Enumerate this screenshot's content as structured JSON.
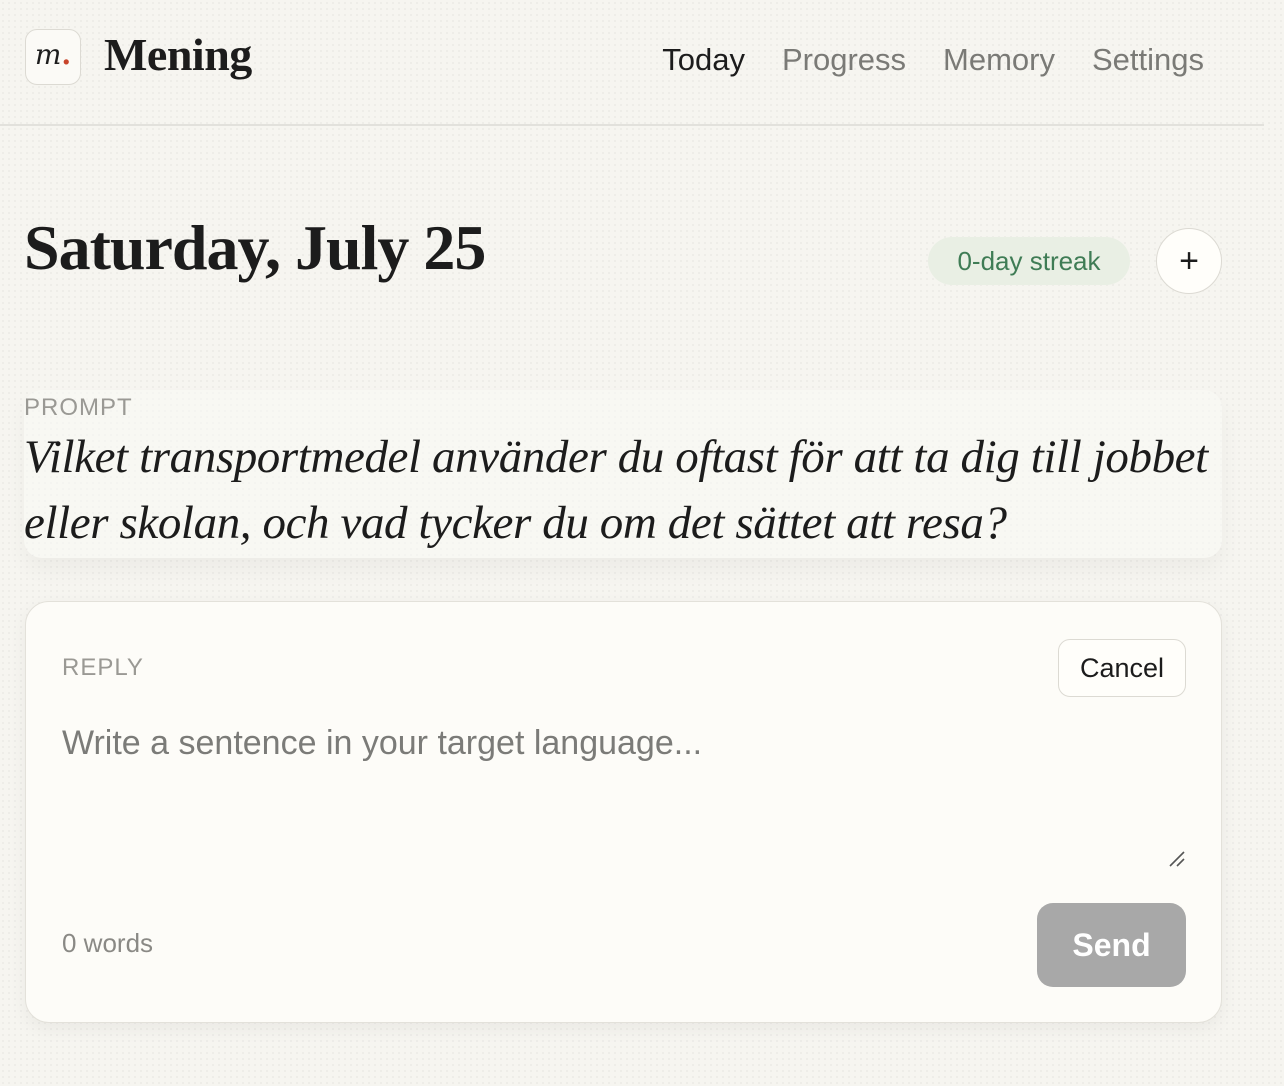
{
  "header": {
    "logo_letter": "m",
    "logo_dot": ".",
    "app_name": "Mening",
    "nav": [
      {
        "label": "Today",
        "active": true
      },
      {
        "label": "Progress",
        "active": false
      },
      {
        "label": "Memory",
        "active": false
      },
      {
        "label": "Settings",
        "active": false
      }
    ]
  },
  "today": {
    "date": "Saturday, July 25",
    "streak": "0-day streak",
    "add_symbol": "+"
  },
  "prompt": {
    "label": "PROMPT",
    "text": "Vilket transportmedel använder du oftast för att ta dig till jobbet eller skolan, och vad tycker du om det sättet att resa?"
  },
  "reply": {
    "label": "REPLY",
    "cancel_label": "Cancel",
    "placeholder": "Write a sentence in your target language...",
    "value": "",
    "word_count": "0 words",
    "send_label": "Send"
  },
  "colors": {
    "background": "#f6f5f0",
    "accent_dot": "#c8442a",
    "streak_bg": "#e9efe4",
    "streak_text": "#3f7c55",
    "send_disabled": "#a8a8a8"
  }
}
